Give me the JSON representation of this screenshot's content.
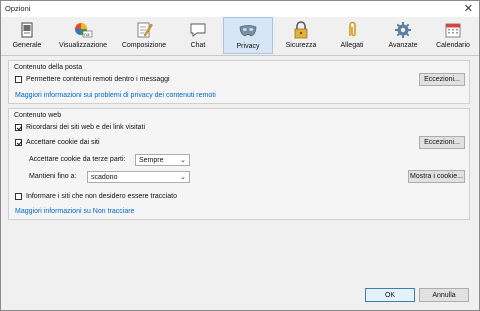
{
  "window": {
    "title": "Opzioni"
  },
  "toolbar": {
    "items": [
      {
        "label": "Generale",
        "icon": "general-icon"
      },
      {
        "label": "Visualizzazione",
        "icon": "display-icon"
      },
      {
        "label": "Composizione",
        "icon": "compose-icon"
      },
      {
        "label": "Chat",
        "icon": "chat-icon"
      },
      {
        "label": "Privacy",
        "icon": "privacy-mask-icon",
        "selected": true
      },
      {
        "label": "Sicurezza",
        "icon": "padlock-icon"
      },
      {
        "label": "Allegati",
        "icon": "paperclip-icon"
      },
      {
        "label": "Avanzate",
        "icon": "gear-icon"
      },
      {
        "label": "Calendario",
        "icon": "calendar-icon"
      }
    ]
  },
  "mail_content": {
    "title": "Contenuto della posta",
    "remote_content_label": "Permettere contenuti remoti dentro i messaggi",
    "remote_content_checked": false,
    "exceptions_label": "Eccezioni...",
    "privacy_link": "Maggiori informazioni sui problemi di privacy dei contenuti remoti"
  },
  "web_content": {
    "title": "Contenuto web",
    "remember_history_label": "Ricordarsi dei siti web e dei link visitati",
    "remember_history_checked": true,
    "accept_cookies_label": "Accettare cookie dai siti",
    "accept_cookies_checked": true,
    "exceptions_label": "Eccezioni...",
    "third_party_label": "Accettare cookie da terze parti:",
    "third_party_value": "Sempre",
    "keep_until_label": "Mantieni fino a:",
    "keep_until_value": "scadono",
    "show_cookies_label": "Mostra i cookie...",
    "dnt_label": "Informare i siti che non desidero essere tracciato",
    "dnt_checked": false,
    "dnt_link": "Maggiori informazioni su Non tracciare"
  },
  "footer": {
    "ok_label": "OK",
    "cancel_label": "Annulla"
  },
  "colors": {
    "selected_tab": "#d6e6f4",
    "link": "#0066cc",
    "primary_border": "#3c7fb1"
  }
}
